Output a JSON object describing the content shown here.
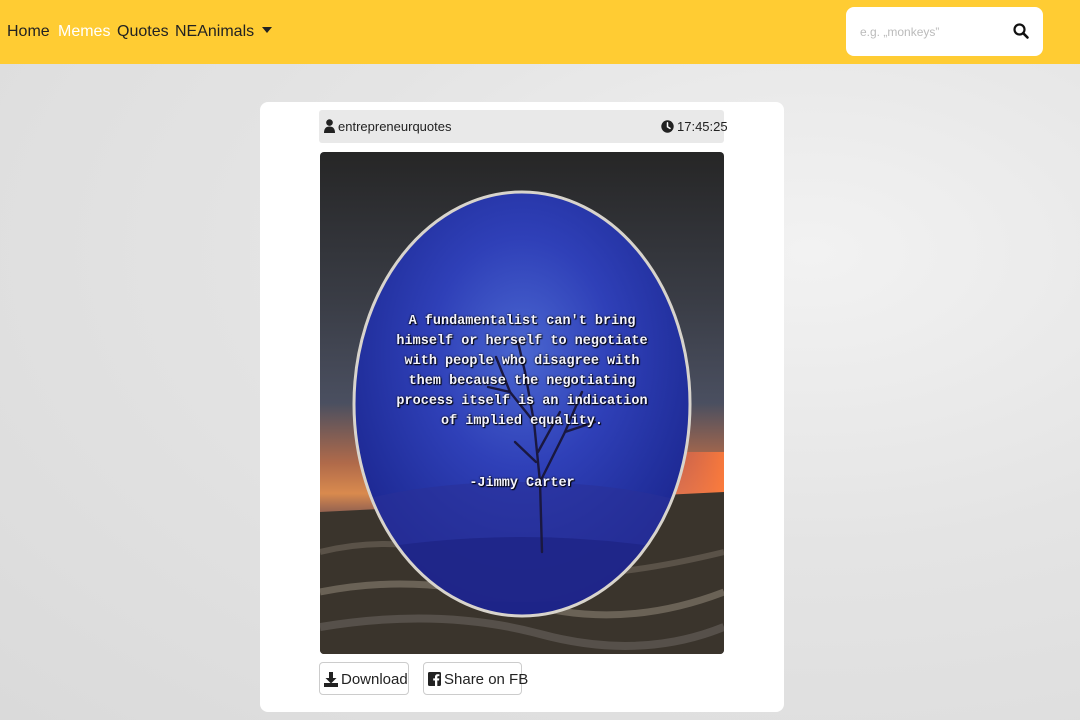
{
  "nav": {
    "items": [
      {
        "label": "Home",
        "active": false
      },
      {
        "label": "Memes",
        "active": true
      },
      {
        "label": "Quotes",
        "active": false
      },
      {
        "label": "NEAnimals",
        "active": false,
        "dropdown": true
      }
    ],
    "search": {
      "placeholder": "e.g. „monkeys”",
      "value": "",
      "icon": "search-icon"
    },
    "color": "#ffcc33"
  },
  "post": {
    "username": "entrepreneurquotes",
    "time": "17:45:25",
    "image": {
      "quote": "A fundamentalist can't bring himself or herself to negotiate with people who disagree with them because the negotiating process itself is an indication of implied equality.",
      "author": "-Jimmy Carter"
    },
    "actions": {
      "download_label": "Download",
      "share_label": "Share on FB"
    }
  }
}
